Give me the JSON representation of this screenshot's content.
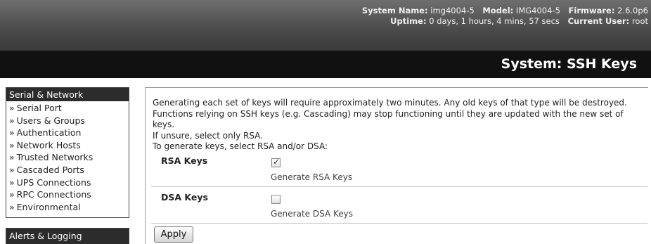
{
  "system_info": {
    "system_name_label": "System Name:",
    "system_name": "img4004-5",
    "model_label": "Model:",
    "model": "IMG4004-5",
    "firmware_label": "Firmware:",
    "firmware": "2.6.0p6",
    "uptime_label": "Uptime:",
    "uptime": "0 days, 1 hours, 4 mins, 57 secs",
    "current_user_label": "Current User:",
    "current_user": "root"
  },
  "page_title": "System: SSH Keys",
  "sidebar": {
    "section_title": "Serial & Network",
    "items": [
      {
        "label": "Serial Port"
      },
      {
        "label": "Users & Groups"
      },
      {
        "label": "Authentication"
      },
      {
        "label": "Network Hosts"
      },
      {
        "label": "Trusted Networks"
      },
      {
        "label": "Cascaded Ports"
      },
      {
        "label": "UPS Connections"
      },
      {
        "label": "RPC Connections"
      },
      {
        "label": "Environmental"
      }
    ],
    "bullet": "»",
    "next_section_title": "Alerts & Logging"
  },
  "content": {
    "intro_line1": "Generating each set of keys will require approximately two minutes. Any old keys of that type will be destroyed.",
    "intro_line2": "Functions relying on SSH keys (e.g. Cascading) may stop functioning until they are updated with the new set of keys.",
    "intro_line3": "If unsure, select only RSA.",
    "instruction": "To generate keys, select RSA and/or DSA:",
    "rsa": {
      "label": "RSA Keys",
      "checkbox_label": "Generate RSA Keys",
      "checked": true
    },
    "dsa": {
      "label": "DSA Keys",
      "checkbox_label": "Generate DSA Keys",
      "checked": false
    },
    "apply_label": "Apply"
  }
}
